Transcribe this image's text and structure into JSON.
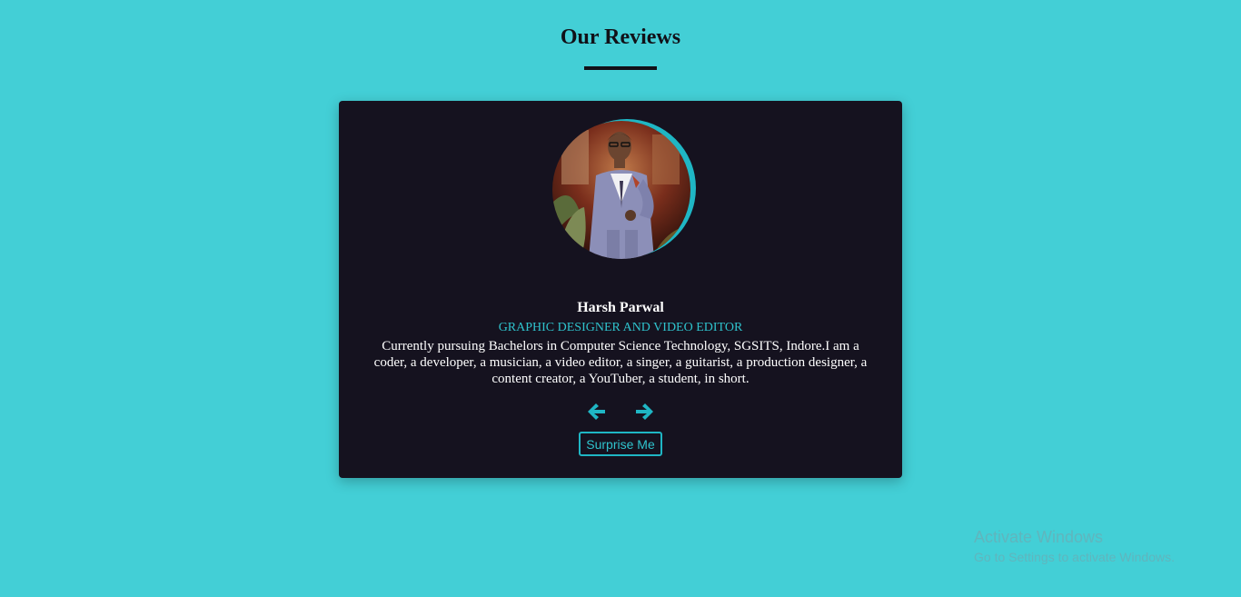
{
  "header": {
    "title": "Our Reviews"
  },
  "review": {
    "name": "Harsh Parwal",
    "role": "Graphic Designer and Video Editor",
    "text": "Currently pursuing Bachelors in Computer Science Technology, SGSITS, Indore.I am a coder, a developer, a musician, a video editor, a singer, a guitarist, a production designer, a content creator, a YouTuber, a student, in short.",
    "avatar_icon": "person-photo"
  },
  "controls": {
    "prev_icon": "arrow-left-icon",
    "next_icon": "arrow-right-icon",
    "surprise_label": "Surprise Me"
  },
  "watermark": {
    "title": "Activate Windows",
    "subtitle": "Go to Settings to activate Windows."
  },
  "colors": {
    "background": "#43cfd6",
    "card": "#15121f",
    "accent": "#1fb6c4",
    "text_dark": "#111118"
  }
}
